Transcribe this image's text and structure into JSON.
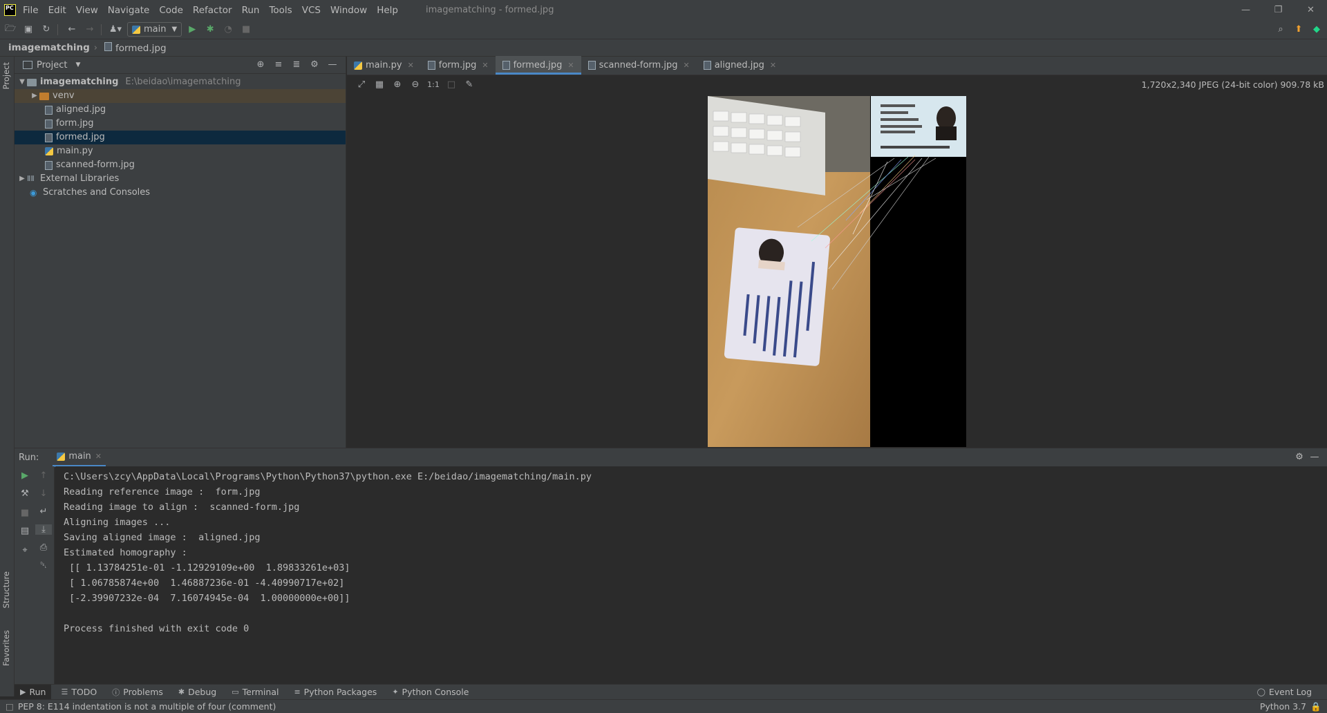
{
  "app": {
    "logo": "PC",
    "title": "imagematching - formed.jpg",
    "menu": [
      "File",
      "Edit",
      "View",
      "Navigate",
      "Code",
      "Refactor",
      "Run",
      "Tools",
      "VCS",
      "Window",
      "Help"
    ]
  },
  "toolbar": {
    "run_config": "main"
  },
  "navbar": {
    "project": "imagematching",
    "file": "formed.jpg"
  },
  "left_strip": {
    "project": "Project",
    "structure": "Structure",
    "favorites": "Favorites"
  },
  "project_panel": {
    "title": "Project",
    "root_name": "imagematching",
    "root_path": "E:\\beidao\\imagematching",
    "items": [
      {
        "label": "venv",
        "type": "folder"
      },
      {
        "label": "aligned.jpg",
        "type": "image"
      },
      {
        "label": "form.jpg",
        "type": "image"
      },
      {
        "label": "formed.jpg",
        "type": "image",
        "selected": true
      },
      {
        "label": "main.py",
        "type": "python"
      },
      {
        "label": "scanned-form.jpg",
        "type": "image"
      }
    ],
    "external": "External Libraries",
    "scratches": "Scratches and Consoles"
  },
  "editor_tabs": [
    {
      "label": "main.py"
    },
    {
      "label": "form.jpg"
    },
    {
      "label": "formed.jpg",
      "active": true
    },
    {
      "label": "scanned-form.jpg"
    },
    {
      "label": "aligned.jpg"
    }
  ],
  "image_viewer": {
    "zoom_label": "1:1",
    "info": "1,720x2,340 JPEG (24-bit color) 909.78 kB"
  },
  "run_panel": {
    "label": "Run:",
    "tab": "main",
    "lines": [
      "C:\\Users\\zcy\\AppData\\Local\\Programs\\Python\\Python37\\python.exe E:/beidao/imagematching/main.py",
      "Reading reference image :  form.jpg",
      "Reading image to align :  scanned-form.jpg",
      "Aligning images ...",
      "Saving aligned image :  aligned.jpg",
      "Estimated homography :",
      " [[ 1.13784251e-01 -1.12929109e+00  1.89833261e+03]",
      " [ 1.06785874e+00  1.46887236e-01 -4.40990717e+02]",
      " [-2.39907232e-04  7.16074945e-04  1.00000000e+00]]",
      "",
      "Process finished with exit code 0"
    ]
  },
  "bottom_tabs": [
    "Run",
    "TODO",
    "Problems",
    "Debug",
    "Terminal",
    "Python Packages",
    "Python Console"
  ],
  "event_log": "Event Log",
  "status": {
    "message": "PEP 8: E114 indentation is not a multiple of four (comment)",
    "interpreter": "Python 3.7"
  }
}
